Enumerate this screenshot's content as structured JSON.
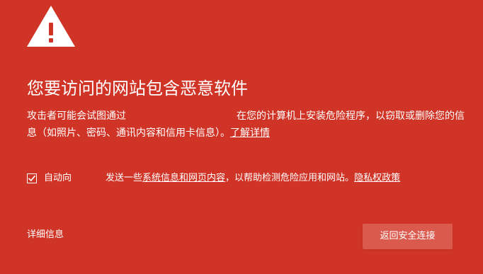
{
  "colors": {
    "background": "#d03426",
    "button_background": "#db5a4e",
    "text": "#ffffff"
  },
  "icon": {
    "name": "warning-icon"
  },
  "title": "您要访问的网站包含恶意软件",
  "body": {
    "line1_before_gap": "攻击者可能会试图通过",
    "line1_after_gap": "在您的计算机上安装危险程序，以窃取或删",
    "line2": "除您的信息（如照片、密码、通讯内容和信用卡信息）。",
    "learn_more": "了解详情"
  },
  "checkbox": {
    "checked": true,
    "label": "自动向",
    "text_before_link": "发送一些",
    "system_info_link": "系统信息和网页内容",
    "text_after_link": "，以帮助检测危险应用和网站。",
    "privacy_link": "隐私权政策"
  },
  "details_link": "详细信息",
  "back_button": "返回安全连接"
}
